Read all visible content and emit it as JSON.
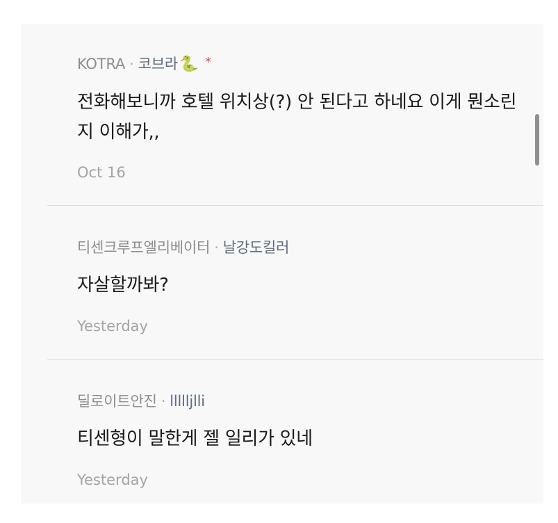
{
  "comments": [
    {
      "author": "KOTRA",
      "nickname": "코브라",
      "emoji": "🐍",
      "marker": "*",
      "text": "전화해보니까 호텔 위치상(?) 안 된다고 하네요 이게 뭔소린지 이해가,,",
      "time": "Oct 16"
    },
    {
      "author": "티센크루프엘리베이터",
      "nickname": "날강도킬러",
      "text": "자살할까봐?",
      "time": "Yesterday"
    },
    {
      "author": "딜로이트안진",
      "nickname": "llllljlli",
      "text": "티센형이 말한게 젤 일리가 있네",
      "time": "Yesterday"
    }
  ],
  "separator": "·",
  "colors": {
    "background": "#f8f8f8",
    "author": "#8d8d8d",
    "nickname": "#5f6b7f",
    "body": "#1a1a1a",
    "time": "#a3a3a3",
    "marker": "#e0474c",
    "divider": "#dedede"
  }
}
